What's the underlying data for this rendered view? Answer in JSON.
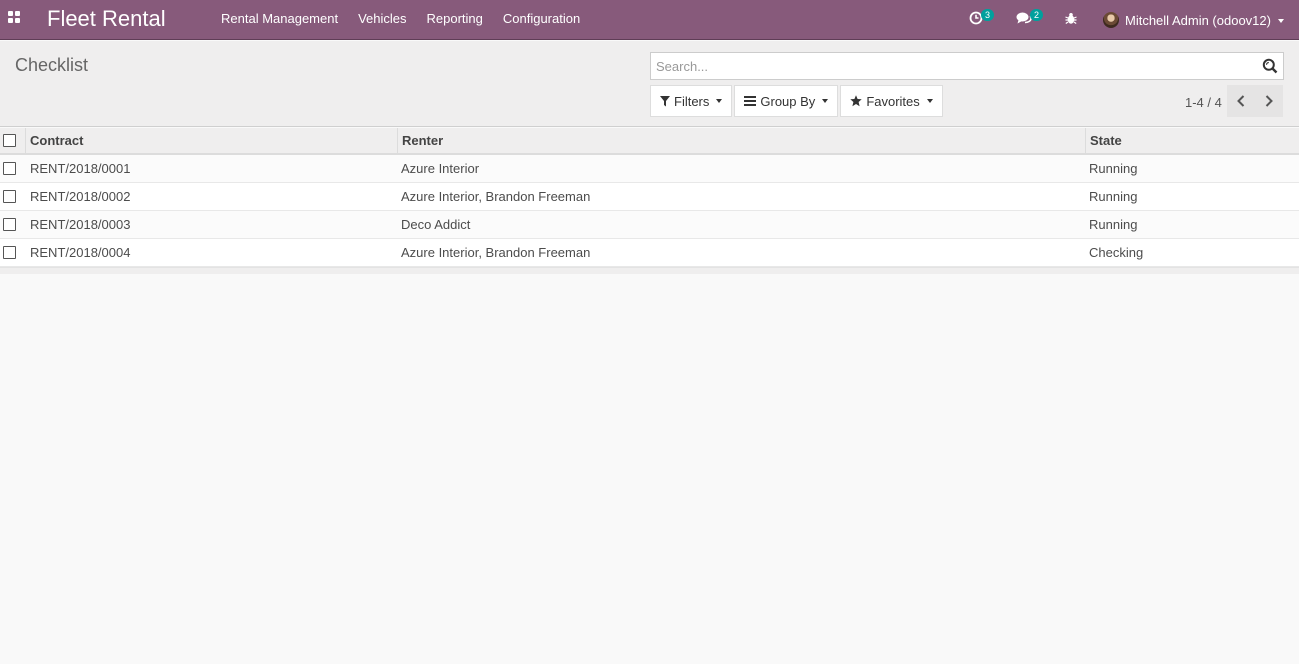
{
  "navbar": {
    "brand": "Fleet Rental",
    "menu": [
      "Rental Management",
      "Vehicles",
      "Reporting",
      "Configuration"
    ],
    "activity_count": "3",
    "messages_count": "2",
    "user_name": "Mitchell Admin (odoov12)",
    "color": "#875a7b"
  },
  "control_panel": {
    "title": "Checklist",
    "search_placeholder": "Search...",
    "filters_label": "Filters",
    "group_by_label": "Group By",
    "favorites_label": "Favorites",
    "pager": "1-4 / 4"
  },
  "table": {
    "columns": [
      "Contract",
      "Renter",
      "State"
    ],
    "rows": [
      {
        "contract": "RENT/2018/0001",
        "renter": "Azure Interior",
        "state": "Running"
      },
      {
        "contract": "RENT/2018/0002",
        "renter": "Azure Interior, Brandon Freeman",
        "state": "Running"
      },
      {
        "contract": "RENT/2018/0003",
        "renter": "Deco Addict",
        "state": "Running"
      },
      {
        "contract": "RENT/2018/0004",
        "renter": "Azure Interior, Brandon Freeman",
        "state": "Checking"
      }
    ]
  }
}
